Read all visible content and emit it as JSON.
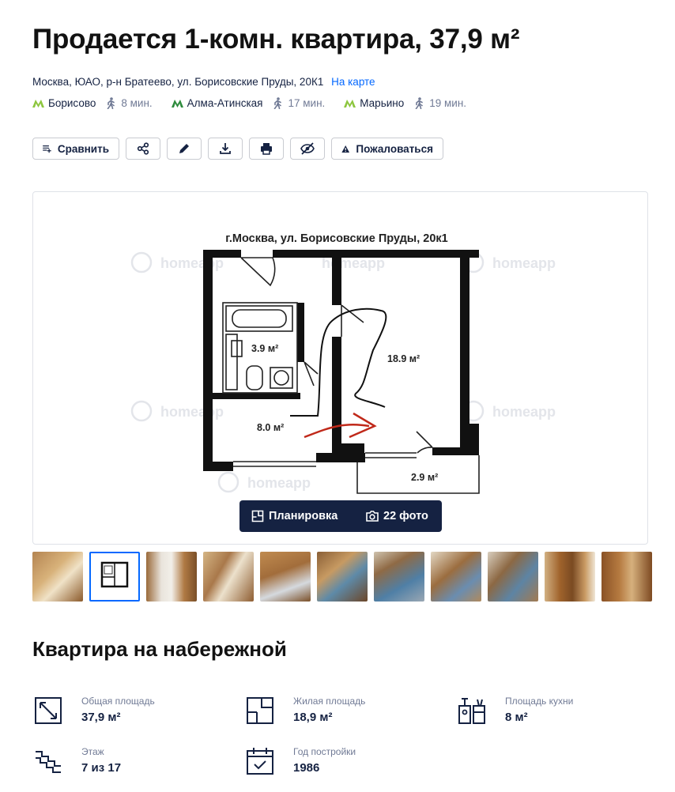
{
  "title": "Продается 1-комн. квартира, 37,9 м²",
  "address": {
    "text": "Москва, ЮАО, р-н Братеево, ул. Борисовские Пруды, 20К1",
    "map_link": "На карте"
  },
  "metro": [
    {
      "name": "Борисово",
      "time": "8 мин.",
      "color": "#8dc63f"
    },
    {
      "name": "Алма-Атинская",
      "time": "17 мин.",
      "color": "#2e8b3d"
    },
    {
      "name": "Марьино",
      "time": "19 мин.",
      "color": "#8dc63f"
    }
  ],
  "actions": {
    "compare": "Сравнить",
    "complain": "Пожаловаться"
  },
  "gallery": {
    "plan_caption": "г.Москва, ул. Борисовские Пруды, 20к1",
    "watermark": "homeapp",
    "rooms": [
      "3.9 м²",
      "18.9 м²",
      "8.0 м²",
      "2.9 м²"
    ],
    "tab_plan": "Планировка",
    "tab_photos": "22 фото"
  },
  "section_title": "Квартира на набережной",
  "facts": [
    {
      "label": "Общая площадь",
      "value": "37,9 м²",
      "icon": "area-icon"
    },
    {
      "label": "Жилая площадь",
      "value": "18,9 м²",
      "icon": "floor-plan-icon"
    },
    {
      "label": "Площадь кухни",
      "value": "8 м²",
      "icon": "kitchen-icon"
    },
    {
      "label": "Этаж",
      "value": "7 из 17",
      "icon": "stairs-icon"
    },
    {
      "label": "Год постройки",
      "value": "1986",
      "icon": "calendar-icon"
    }
  ],
  "colors": {
    "primary": "#152242",
    "link": "#0468ff",
    "secondary_text": "#707a95",
    "border": "#c9cbd1"
  }
}
